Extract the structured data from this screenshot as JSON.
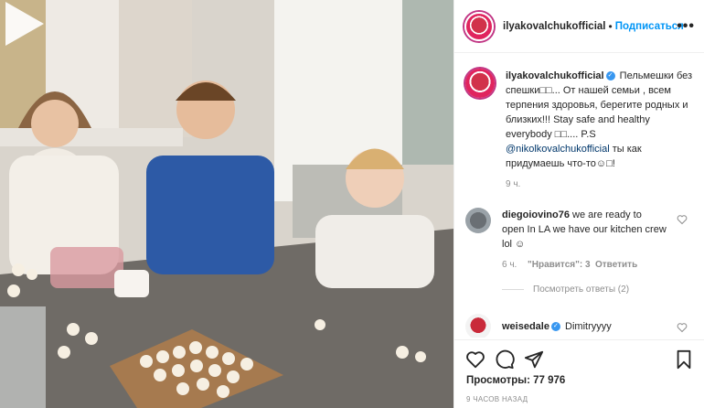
{
  "post": {
    "username": "ilyakovalchukofficial",
    "separator": "•",
    "follow_label": "Подписаться",
    "more_label": "•••"
  },
  "caption": {
    "username": "ilyakovalchukofficial",
    "text_1": "Пельмешки без спешки□□... От нашей семьи , всем терпения здоровья, берегите родных и близких!!! Stay safe and healthy everybody □□.... P.S",
    "mention": "@nikolkovalchukofficial",
    "text_2": "ты как придумаешь что-то☺□!",
    "time": "9 ч."
  },
  "comments": [
    {
      "username": "diegoiovino76",
      "text": "we are ready to open In LA we have our kitchen crew lol ☺",
      "time": "6 ч.",
      "likes": "\"Нравится\": 3",
      "reply_label": "Ответить",
      "view_replies": "Посмотреть ответы (2)"
    },
    {
      "username": "weisedale",
      "text": "Dimitryyyy"
    }
  ],
  "stats": {
    "views": "Просмотры: 77 976",
    "timestamp": "9 ЧАСОВ НАЗАД"
  }
}
